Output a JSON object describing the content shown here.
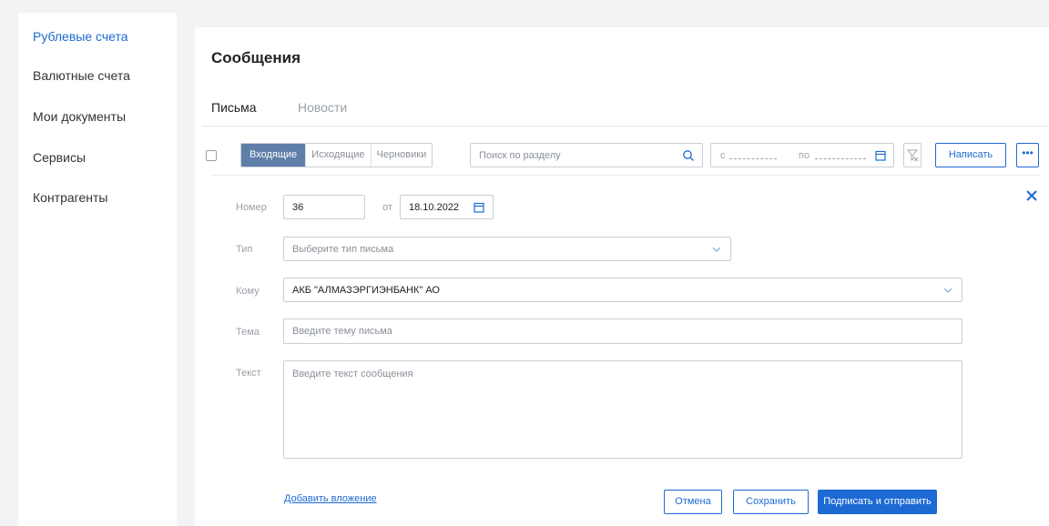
{
  "sidebar": {
    "items": [
      {
        "label": "Рублевые счета",
        "active": true
      },
      {
        "label": "Валютные счета",
        "active": false
      },
      {
        "label": "Мои документы",
        "active": false
      },
      {
        "label": "Сервисы",
        "active": false
      },
      {
        "label": "Контрагенты",
        "active": false
      }
    ]
  },
  "main": {
    "title": "Сообщения",
    "tabs": [
      {
        "label": "Письма",
        "active": true
      },
      {
        "label": "Новости",
        "active": false
      }
    ]
  },
  "toolbar": {
    "segments": [
      {
        "label": "Входящие",
        "active": true
      },
      {
        "label": "Исходящие",
        "active": false
      },
      {
        "label": "Черновики",
        "active": false
      }
    ],
    "search_placeholder": "Поиск по разделу",
    "date_from_label": "с",
    "date_to_label": "по",
    "write_label": "Написать",
    "more_label": "•••"
  },
  "form": {
    "number_label": "Номер",
    "number_value": "36",
    "from_label": "от",
    "date_value": "18.10.2022",
    "type_label": "Тип",
    "type_placeholder": "Выберите тип письма",
    "to_label": "Кому",
    "to_value": "АКБ \"АЛМАЗЭРГИЭНБАНК\" АО",
    "subject_label": "Тема",
    "subject_placeholder": "Введите тему письма",
    "text_label": "Текст",
    "text_placeholder": "Введите текст сообщения",
    "attach_label": "Добавить вложение",
    "cancel_label": "Отмена",
    "save_label": "Сохранить",
    "sign_send_label": "Подписать и отправить"
  },
  "colors": {
    "accent": "#1d6ad4",
    "segment_active": "#5f7ea8",
    "background": "#f2f3f5"
  },
  "icons": [
    "search-icon",
    "calendar-icon",
    "filter-clear-icon",
    "close-icon",
    "chevron-down-icon"
  ]
}
